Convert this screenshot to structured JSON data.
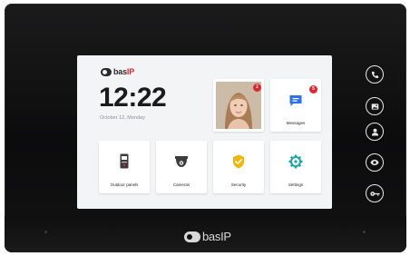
{
  "brand": {
    "name": "bas",
    "suffix": "IP"
  },
  "home": {
    "time": "12:22",
    "date": "October 12, Monday"
  },
  "tiles": {
    "photo_badge": "2",
    "messages_label": "Messages",
    "messages_badge": "5",
    "outdoor_label": "Outdoor panels",
    "cameras_label": "Cameras",
    "security_label": "Security",
    "settings_label": "Settings"
  },
  "side_buttons": [
    "phone-icon",
    "gallery-icon",
    "user-icon",
    "eye-icon",
    "key-icon"
  ],
  "colors": {
    "accent": "#e3232d",
    "messages": "#2f73e8",
    "security": "#f4b400",
    "settings": "#18a7a1"
  }
}
